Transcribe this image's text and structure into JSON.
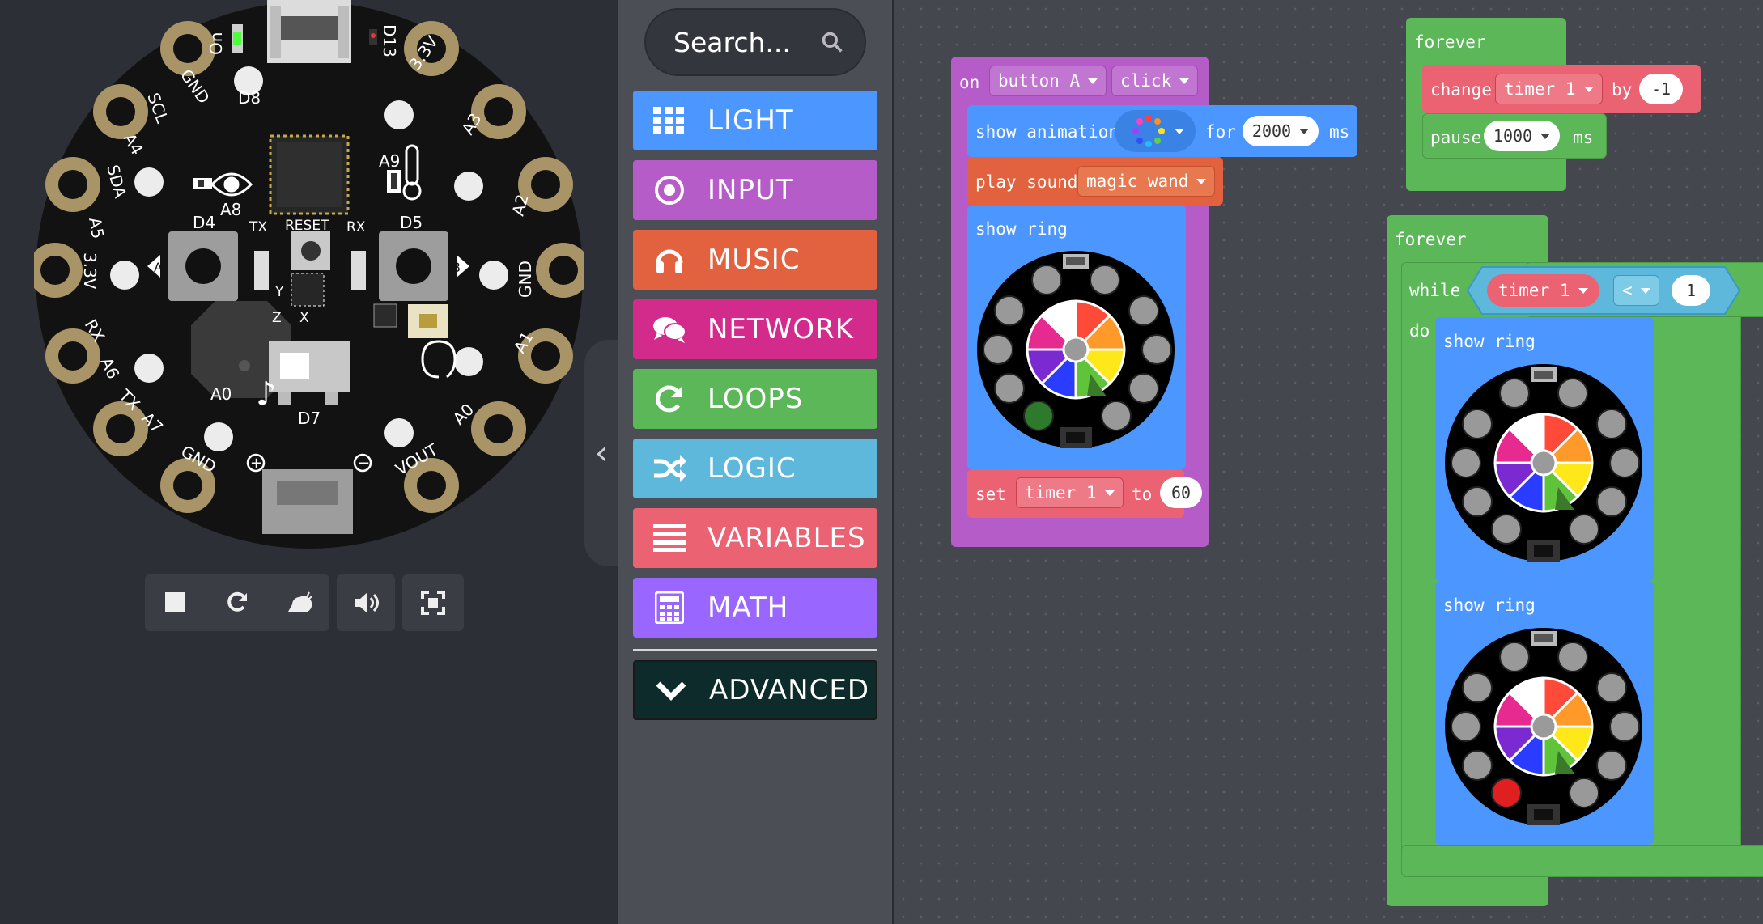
{
  "simulator": {
    "board_labels": {
      "on": "On",
      "d13": "D13",
      "gnd_tl": "GND",
      "v33_tr": "3.3V",
      "d8": "D8",
      "scl": "SCL",
      "a4": "A4",
      "a3": "A3",
      "sda": "SDA",
      "a5": "A5",
      "a2": "A2",
      "a8": "A8",
      "a9": "A9",
      "d4": "D4",
      "tx_top": "TX",
      "reset": "RESET",
      "rx_top": "RX",
      "d5": "D5",
      "v33_l": "3.3V",
      "gnd_r": "GND",
      "btn_a": "A",
      "btn_b": "B",
      "y": "Y",
      "z": "Z",
      "x": "X",
      "rx_l": "RX",
      "a6": "A6",
      "a1": "A1",
      "a0_mid": "A0",
      "d7": "D7",
      "tx_l": "TX",
      "a7": "A7",
      "a0_r": "A0",
      "gnd_b": "GND",
      "vout": "VOUT"
    }
  },
  "toolbox": {
    "search_placeholder": "Search...",
    "categories": [
      {
        "label": "LIGHT",
        "color": "#4c97ff"
      },
      {
        "label": "INPUT",
        "color": "#b65cc9"
      },
      {
        "label": "MUSIC",
        "color": "#e2613e"
      },
      {
        "label": "NETWORK",
        "color": "#d22b8c"
      },
      {
        "label": "LOOPS",
        "color": "#5bb757"
      },
      {
        "label": "LOGIC",
        "color": "#5eb8dc"
      },
      {
        "label": "VARIABLES",
        "color": "#eb6272"
      },
      {
        "label": "MATH",
        "color": "#9966ff"
      }
    ],
    "advanced_label": "ADVANCED"
  },
  "blocks": {
    "event": {
      "on": "on",
      "button": "button A",
      "action": "click",
      "show_animation": "show animation",
      "for": "for",
      "duration": "2000",
      "ms": "ms",
      "play_sound": "play sound",
      "sound": "magic wand",
      "show_ring": "show ring",
      "set": "set",
      "var": "timer 1",
      "to": "to",
      "value": "60"
    },
    "forever1": {
      "title": "forever",
      "change": "change",
      "var": "timer 1",
      "by": "by",
      "by_value": "-1",
      "pause": "pause",
      "pause_value": "1000",
      "ms": "ms"
    },
    "forever2": {
      "title": "forever",
      "while": "while",
      "do": "do",
      "var": "timer 1",
      "op": "<",
      "value": "1",
      "show_ring1": "show ring",
      "show_ring2": "show ring"
    }
  }
}
